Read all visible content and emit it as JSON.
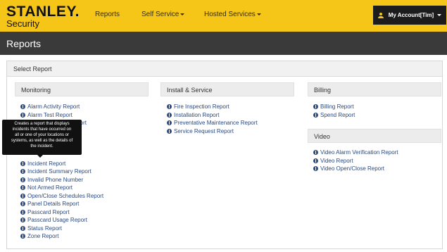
{
  "brand": {
    "name": "STANLEY",
    "dot": ".",
    "sub": "Security"
  },
  "nav": {
    "reports": "Reports",
    "self_service": "Self Service",
    "hosted_services": "Hosted Services",
    "account": "My Account[Tim]"
  },
  "page_title": "Reports",
  "panel_title": "Select Report",
  "sections": {
    "monitoring": {
      "title": "Monitoring",
      "items": [
        "Alarm Activity Report",
        "Alarm Test Report",
        "Report",
        "Incident Report",
        "Incident Summary Report",
        "Invalid Phone Number",
        "Not Armed Report",
        "Open/Close Schedules Report",
        "Panel Details Report",
        "Passcard Report",
        "Passcard Usage Report",
        "Status Report",
        "Zone Report"
      ]
    },
    "install": {
      "title": "Install & Service",
      "items": [
        "Fire Inspection Report",
        "Installation Report",
        "Preventative Maintenance Report",
        "Service Request Report"
      ]
    },
    "billing": {
      "title": "Billing",
      "items": [
        "Billing Report",
        "Spend Report"
      ]
    },
    "video": {
      "title": "Video",
      "items": [
        "Video Alarm Verification Report",
        "Video Report",
        "Video Open/Close Report"
      ]
    }
  },
  "tooltip": {
    "lines": [
      "Creates a report that displays",
      "incidents that have occurred on",
      "all or one of your locations or",
      "systems, as well as the details of",
      "the incident."
    ]
  },
  "colors": {
    "accent": "#f5c518",
    "link": "#2b4a80",
    "titlebar": "#3a3a3a"
  }
}
